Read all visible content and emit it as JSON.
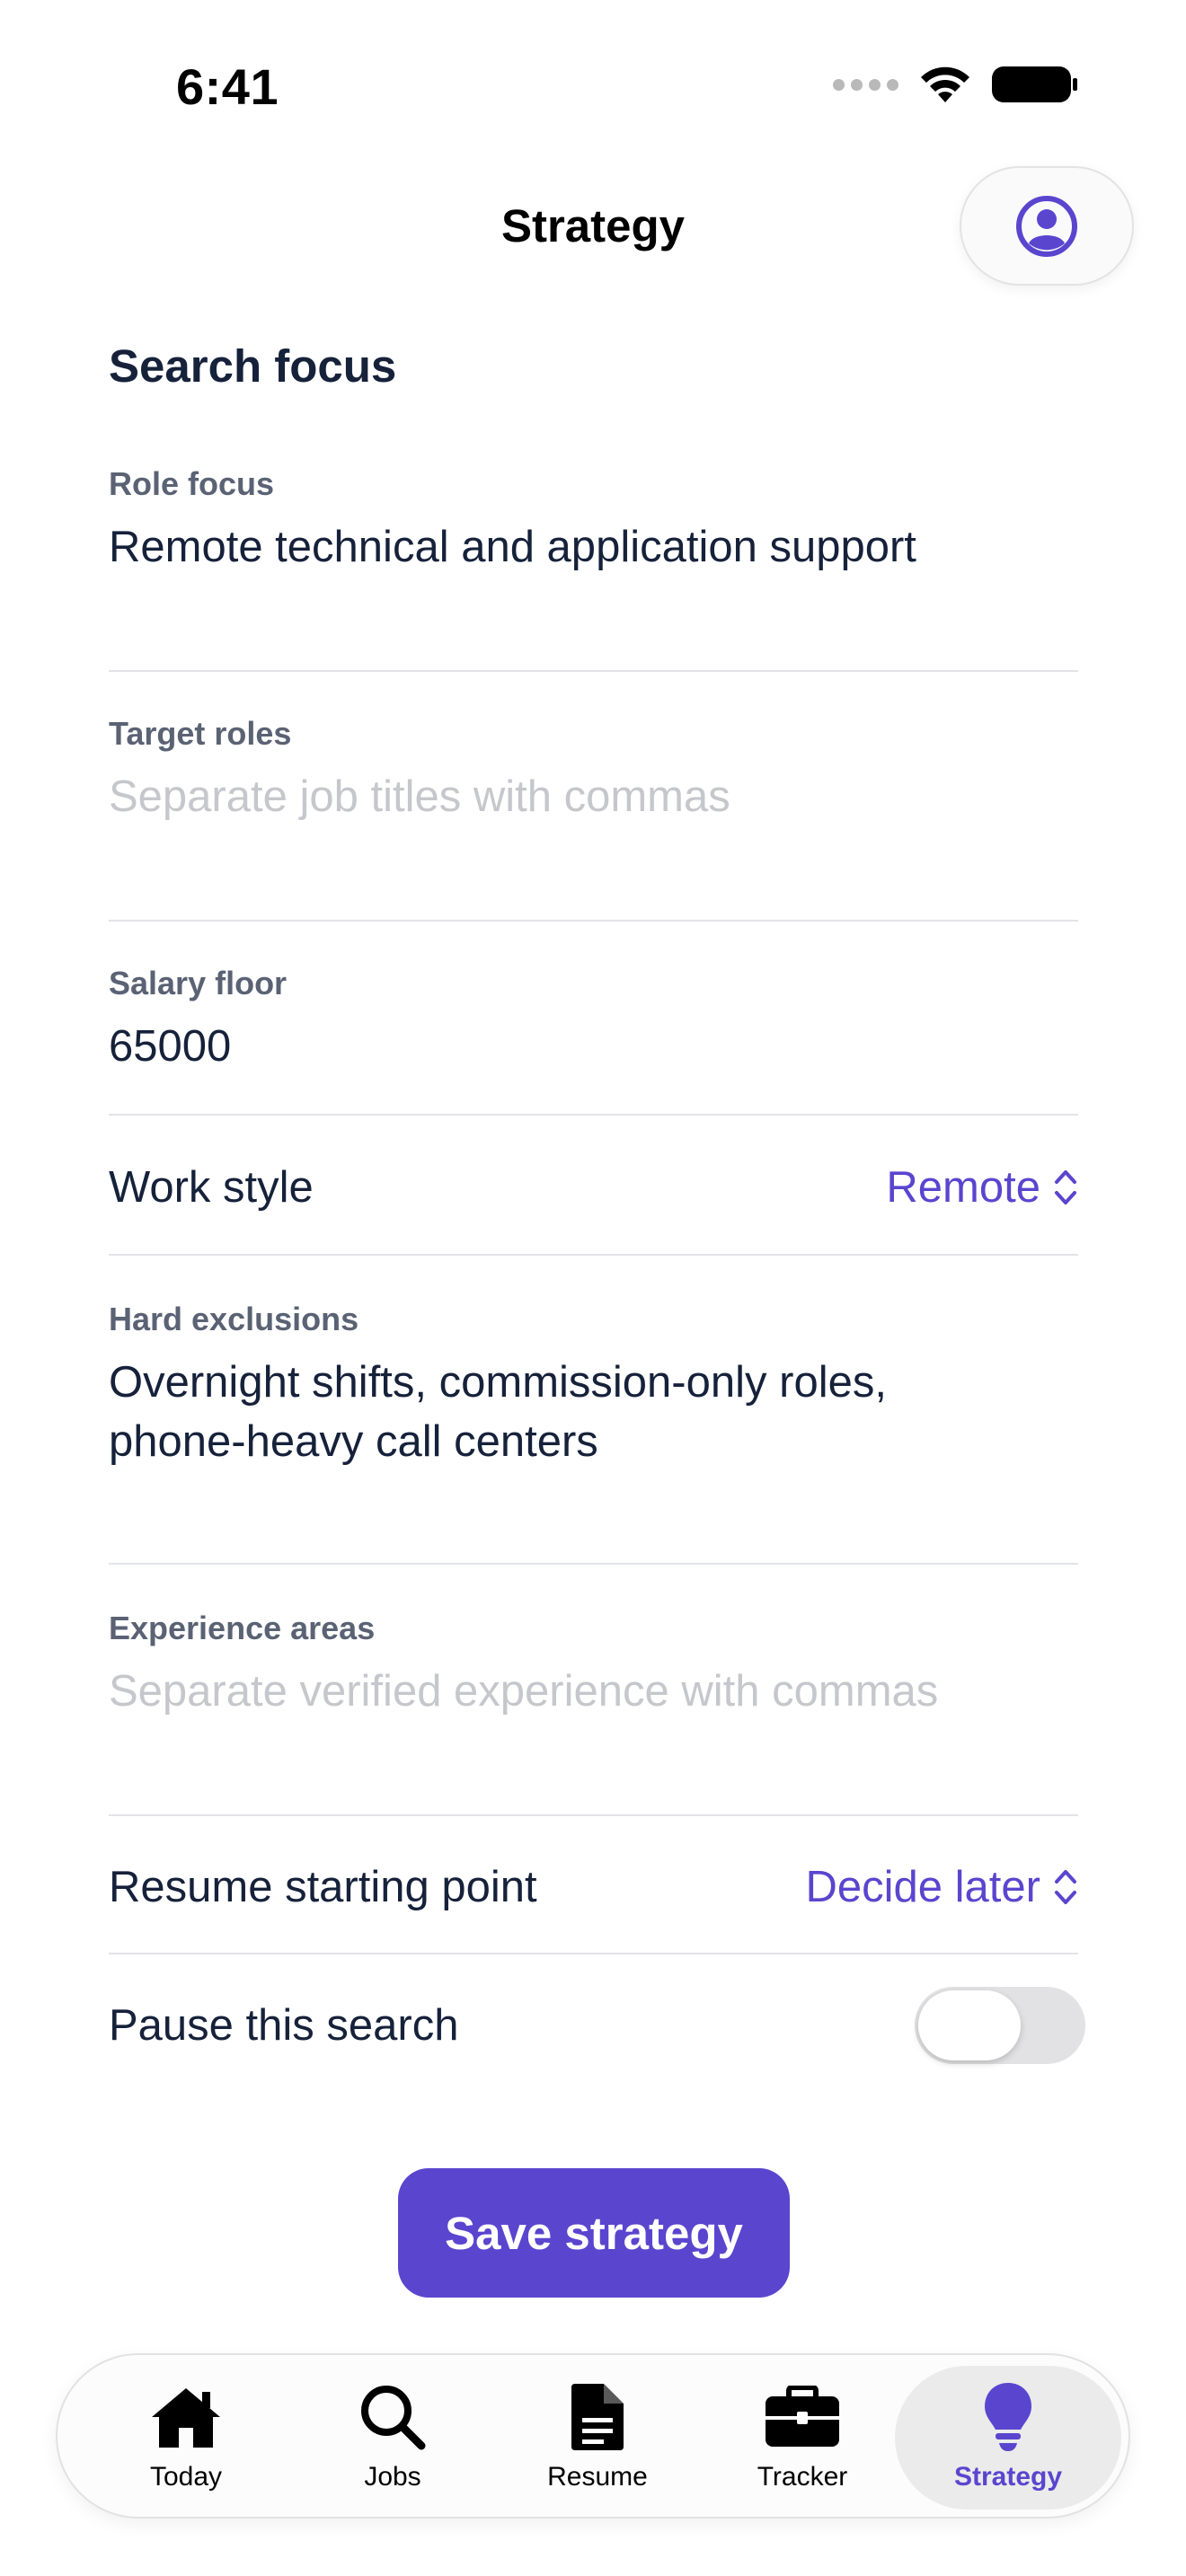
{
  "status_bar": {
    "time": "6:41"
  },
  "header": {
    "title": "Strategy",
    "profile_icon": "person-circle-icon"
  },
  "section": {
    "title": "Search focus"
  },
  "fields": {
    "role_focus": {
      "label": "Role focus",
      "value": "Remote technical and application support"
    },
    "target_roles": {
      "label": "Target roles",
      "placeholder": "Separate job titles with commas"
    },
    "salary_floor": {
      "label": "Salary floor",
      "value": "65000"
    },
    "work_style": {
      "label": "Work style",
      "value": "Remote"
    },
    "hard_exclusions": {
      "label": "Hard exclusions",
      "value_line1": "Overnight shifts, commission-only roles,",
      "value_line2": "phone-heavy call centers"
    },
    "experience_areas": {
      "label": "Experience areas",
      "placeholder": "Separate verified experience with commas"
    },
    "resume_starting_point": {
      "label": "Resume starting point",
      "value": "Decide later"
    },
    "pause_search": {
      "label": "Pause this search",
      "enabled": false
    }
  },
  "save_button": {
    "label": "Save strategy"
  },
  "tabs": [
    {
      "label": "Today",
      "icon": "house-icon",
      "active": false
    },
    {
      "label": "Jobs",
      "icon": "magnifying-glass-icon",
      "active": false
    },
    {
      "label": "Resume",
      "icon": "document-icon",
      "active": false
    },
    {
      "label": "Tracker",
      "icon": "briefcase-icon",
      "active": false
    },
    {
      "label": "Strategy",
      "icon": "lightbulb-icon",
      "active": true
    }
  ],
  "colors": {
    "accent": "#5a45cf",
    "text": "#16213a",
    "label": "#5a6274",
    "placeholder": "#c6c7cc",
    "divider": "#e3e4e8"
  }
}
